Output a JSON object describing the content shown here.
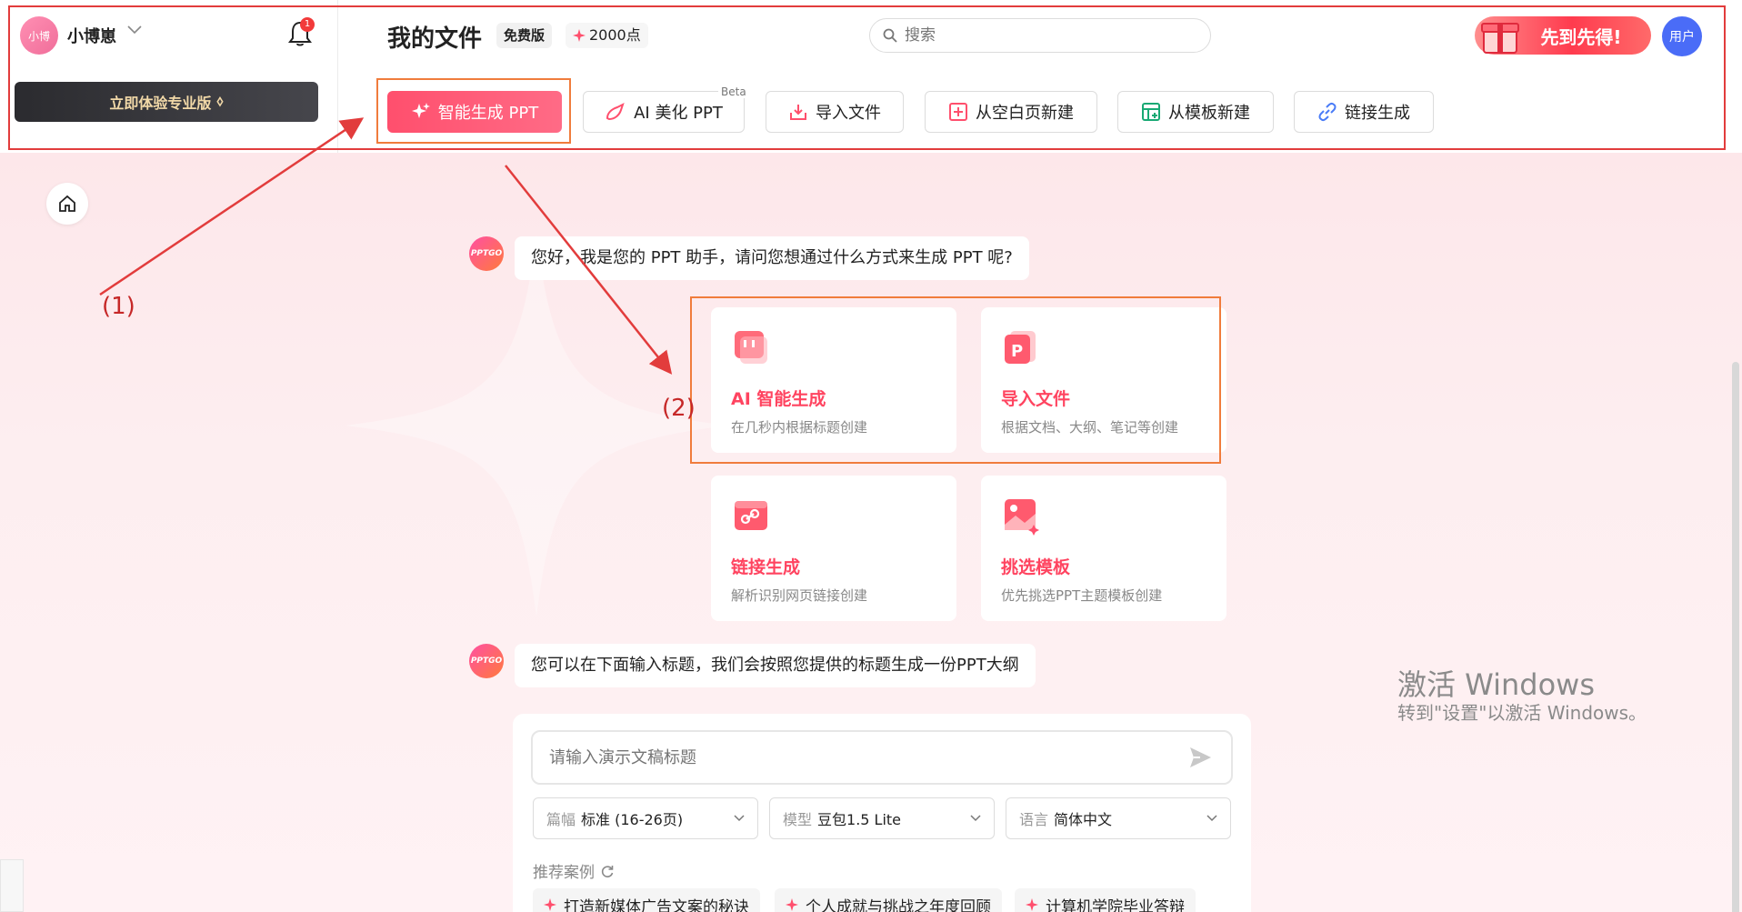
{
  "user": {
    "avatar_text": "小博",
    "name": "小博崽",
    "notifications": "1",
    "caret": "⌄"
  },
  "pro_button": {
    "label": "立即体验专业版",
    "icon": "⬨"
  },
  "header": {
    "title": "我的文件",
    "plan_badge": "免费版",
    "points": "2000点",
    "search_placeholder": "搜索",
    "promo": "先到先得!",
    "user_button": "用户"
  },
  "toolbar": {
    "items": [
      {
        "label": "智能生成 PPT",
        "icon": "sparkle-icon"
      },
      {
        "label": "AI 美化 PPT",
        "icon": "brush-icon",
        "badge": "Beta"
      },
      {
        "label": "导入文件",
        "icon": "import-icon"
      },
      {
        "label": "从空白页新建",
        "icon": "plus-square-icon"
      },
      {
        "label": "从模板新建",
        "icon": "template-icon"
      },
      {
        "label": "链接生成",
        "icon": "link-icon"
      }
    ]
  },
  "annotations": {
    "label1": "(1)",
    "label2": "(2)"
  },
  "chat": {
    "bot_avatar": "PPTGO",
    "greeting": "您好，我是您的 PPT 助手，请问您想通过什么方式来生成 PPT 呢?",
    "prompt": "您可以在下面输入标题，我们会按照您提供的标题生成一份PPT大纲"
  },
  "cards": [
    {
      "title": "AI 智能生成",
      "desc": "在几秒内根据标题创建",
      "icon": "chat-icon"
    },
    {
      "title": "导入文件",
      "desc": "根据文档、大纲、笔记等创建",
      "icon": "ppt-file-icon"
    },
    {
      "title": "链接生成",
      "desc": "解析识别网页链接创建",
      "icon": "link-card-icon"
    },
    {
      "title": "挑选模板",
      "desc": "优先挑选PPT主题模板创建",
      "icon": "image-template-icon"
    }
  ],
  "composer": {
    "placeholder": "请输入演示文稿标题",
    "length": {
      "key": "篇幅",
      "value": "标准 (16-26页)"
    },
    "model": {
      "key": "模型",
      "value": "豆包1.5 Lite"
    },
    "language": {
      "key": "语言",
      "value": "简体中文"
    },
    "recommended_label": "推荐案例",
    "recommendations": [
      "打造新媒体广告文案的秘诀",
      "个人成就与挑战之年度回顾",
      "计算机学院毕业答辩"
    ]
  },
  "watermark": {
    "line1": "激活 Windows",
    "line2": "转到\"设置\"以激活 Windows。"
  },
  "colors": {
    "accent": "#ff4f6d",
    "annotation_red": "#e23c3c",
    "annotation_orange": "#f07c3c",
    "user_blue": "#4a6cf7"
  }
}
